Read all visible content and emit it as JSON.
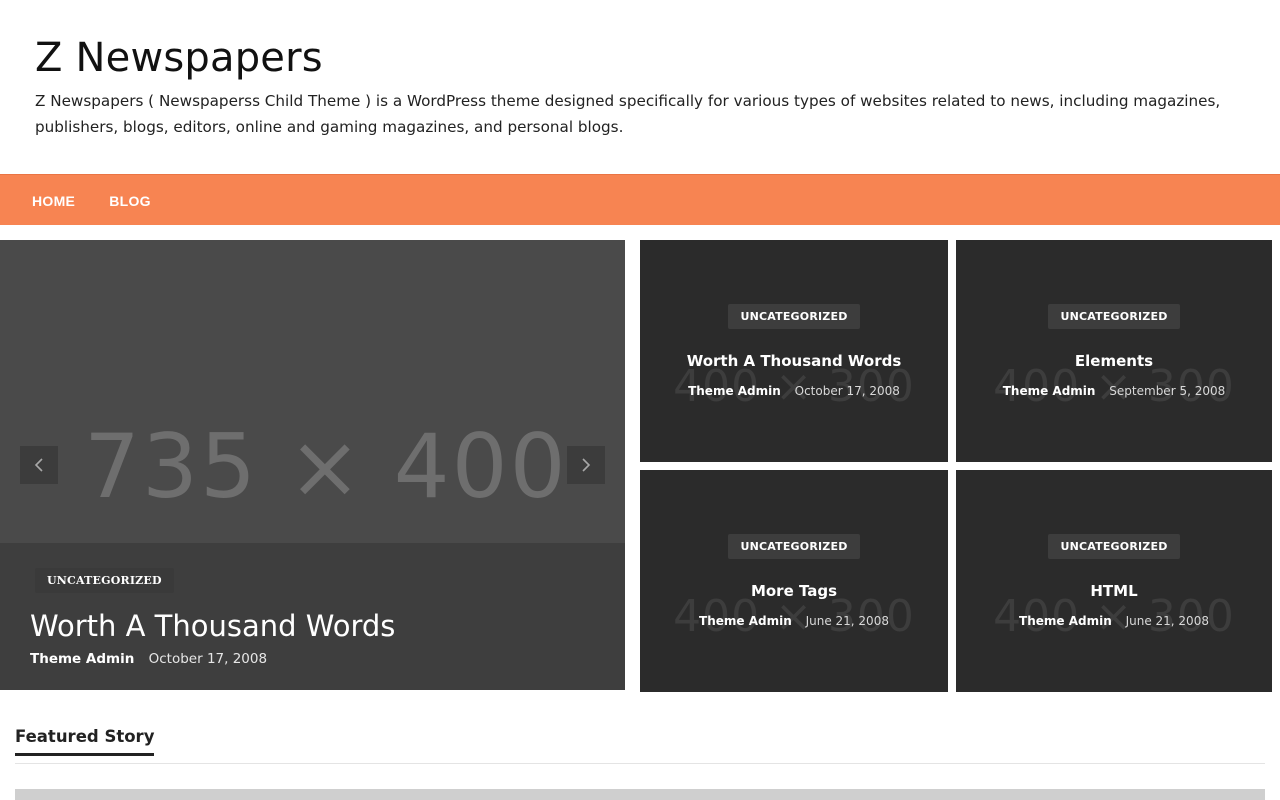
{
  "site": {
    "title": "Z Newspapers",
    "description": "Z Newspapers ( Newspaperss Child Theme ) is a WordPress theme designed specifically for various types of websites related to news, including magazines, publishers, blogs, editors, online and gaming magazines, and personal blogs."
  },
  "nav": {
    "items": [
      {
        "label": "HOME"
      },
      {
        "label": "BLOG"
      }
    ]
  },
  "hero": {
    "placeholder": "735 × 400",
    "category": "UNCATEGORIZED",
    "title": "Worth A Thousand Words",
    "author": "Theme Admin",
    "date": "October 17, 2008",
    "prev_icon": "chevron-left-icon",
    "next_icon": "chevron-right-icon"
  },
  "cards": [
    {
      "placeholder": "400 × 300",
      "category": "UNCATEGORIZED",
      "title": "Worth A Thousand Words",
      "author": "Theme Admin",
      "date": "October 17, 2008"
    },
    {
      "placeholder": "400 × 300",
      "category": "UNCATEGORIZED",
      "title": "Elements",
      "author": "Theme Admin",
      "date": "September 5, 2008"
    },
    {
      "placeholder": "400 × 300",
      "category": "UNCATEGORIZED",
      "title": "More Tags",
      "author": "Theme Admin",
      "date": "June 21, 2008"
    },
    {
      "placeholder": "400 × 300",
      "category": "UNCATEGORIZED",
      "title": "HTML",
      "author": "Theme Admin",
      "date": "June 21, 2008"
    }
  ],
  "featured": {
    "title": "Featured Story"
  },
  "colors": {
    "nav_bg": "#f78452",
    "card_bg": "#2b2b2b",
    "hero_bg": "#4a4a4a"
  }
}
